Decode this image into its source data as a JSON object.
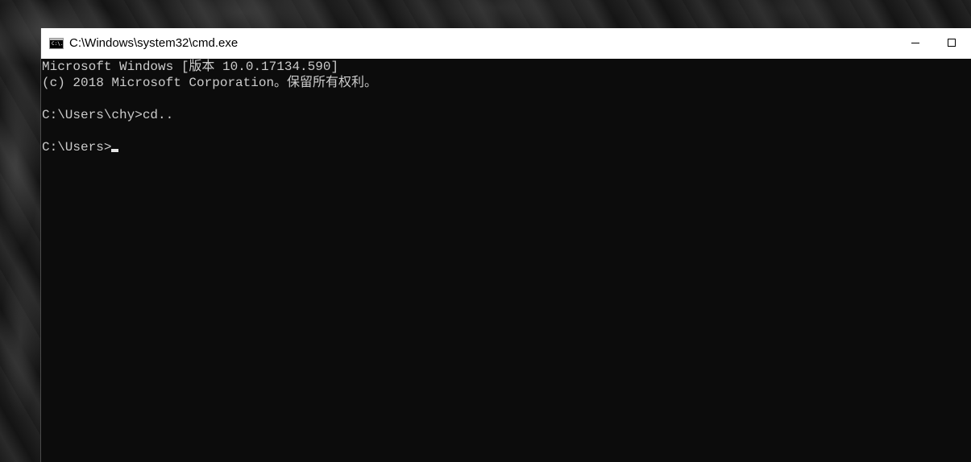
{
  "window": {
    "title": "C:\\Windows\\system32\\cmd.exe",
    "app_icon_label": "C:\\."
  },
  "console": {
    "lines": [
      "Microsoft Windows [版本 10.0.17134.590]",
      "(c) 2018 Microsoft Corporation。保留所有权利。",
      "",
      "C:\\Users\\chy>cd..",
      "",
      "C:\\Users>"
    ]
  },
  "colors": {
    "console_background": "#0c0c0c",
    "console_text": "#cccccc",
    "titlebar_background": "#ffffff"
  }
}
